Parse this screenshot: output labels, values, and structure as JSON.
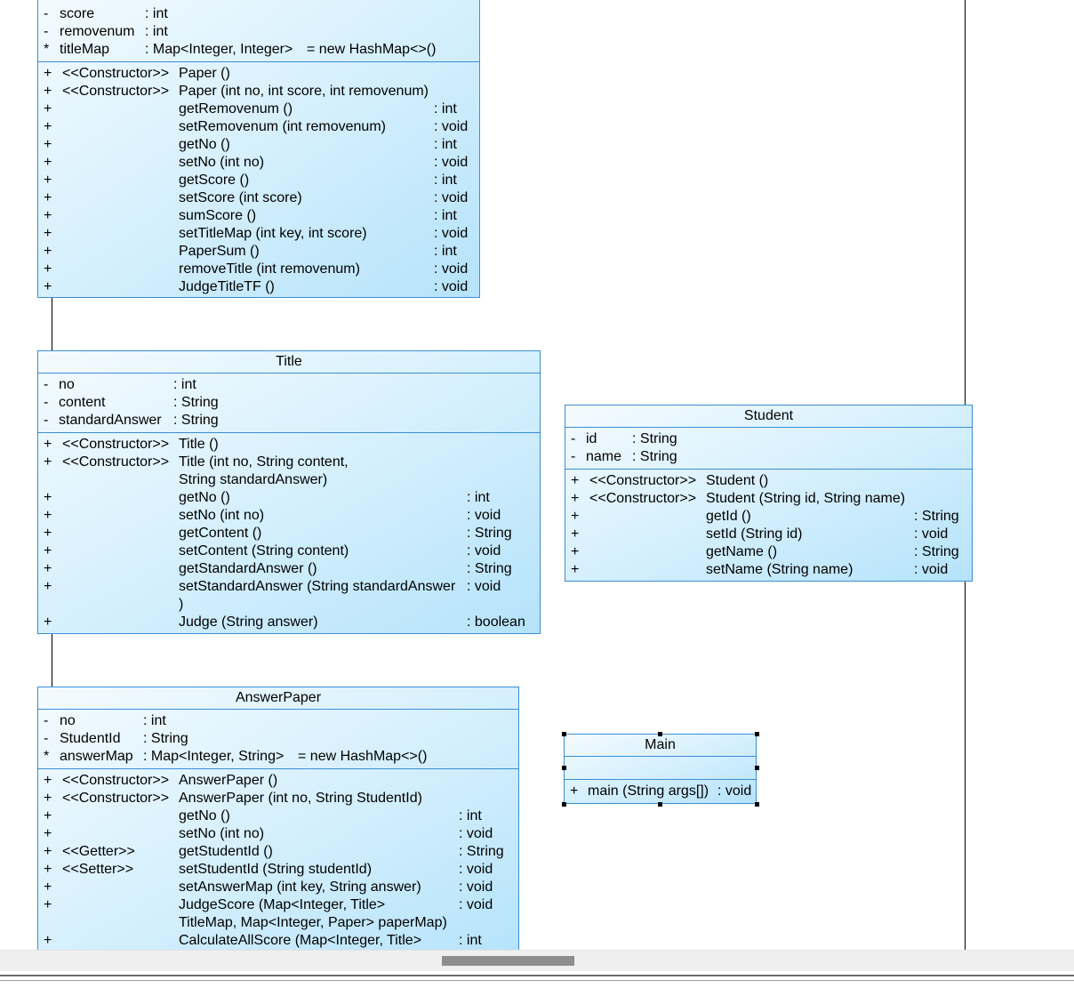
{
  "paper": {
    "attributes": [
      {
        "vis": "-",
        "name": "score",
        "type": ": int"
      },
      {
        "vis": "-",
        "name": "removenum",
        "type": ": int"
      },
      {
        "vis": "*",
        "name": "titleMap",
        "type": ": Map<Integer, Integer>",
        "init": "= new HashMap<>()"
      }
    ],
    "operations": [
      {
        "vis": "+",
        "stereo": "<<Constructor>>",
        "sig": "Paper ()",
        "ret": ""
      },
      {
        "vis": "+",
        "stereo": "<<Constructor>>",
        "sig": "Paper (int no, int score, int removenum)",
        "ret": ""
      },
      {
        "vis": "+",
        "stereo": "",
        "sig": "getRemovenum ()",
        "ret": ": int"
      },
      {
        "vis": "+",
        "stereo": "",
        "sig": "setRemovenum (int removenum)",
        "ret": ": void"
      },
      {
        "vis": "+",
        "stereo": "",
        "sig": "getNo ()",
        "ret": ": int"
      },
      {
        "vis": "+",
        "stereo": "",
        "sig": "setNo (int no)",
        "ret": ": void"
      },
      {
        "vis": "+",
        "stereo": "",
        "sig": "getScore ()",
        "ret": ": int"
      },
      {
        "vis": "+",
        "stereo": "",
        "sig": "setScore (int score)",
        "ret": ": void"
      },
      {
        "vis": "+",
        "stereo": "",
        "sig": "sumScore ()",
        "ret": ": int"
      },
      {
        "vis": "+",
        "stereo": "",
        "sig": "setTitleMap (int key, int score)",
        "ret": ": void"
      },
      {
        "vis": "+",
        "stereo": "",
        "sig": "PaperSum ()",
        "ret": ": int"
      },
      {
        "vis": "+",
        "stereo": "",
        "sig": "removeTitle (int removenum)",
        "ret": ": void"
      },
      {
        "vis": "+",
        "stereo": "",
        "sig": "JudgeTitleTF ()",
        "ret": ": void"
      }
    ]
  },
  "title_class": {
    "name": "Title",
    "attributes": [
      {
        "vis": "-",
        "name": "no",
        "type": ": int"
      },
      {
        "vis": "-",
        "name": "content",
        "type": ": String"
      },
      {
        "vis": "-",
        "name": "standardAnswer",
        "type": ": String"
      }
    ],
    "operations": [
      {
        "vis": "+",
        "stereo": "<<Constructor>>",
        "sig": "Title ()",
        "ret": ""
      },
      {
        "vis": "+",
        "stereo": "<<Constructor>>",
        "sig": "Title (int no, String content,",
        "ret": ""
      },
      {
        "vis": "",
        "stereo": "",
        "sig": " String standardAnswer)",
        "ret": ""
      },
      {
        "vis": "+",
        "stereo": "",
        "sig": "getNo ()",
        "ret": ": int"
      },
      {
        "vis": "+",
        "stereo": "",
        "sig": "setNo (int no)",
        "ret": ": void"
      },
      {
        "vis": "+",
        "stereo": "",
        "sig": "getContent ()",
        "ret": ": String"
      },
      {
        "vis": "+",
        "stereo": "",
        "sig": "setContent (String content)",
        "ret": ": void"
      },
      {
        "vis": "+",
        "stereo": "",
        "sig": "getStandardAnswer ()",
        "ret": ": String"
      },
      {
        "vis": "+",
        "stereo": "",
        "sig": "setStandardAnswer (String standardAnswer",
        "ret": ": void"
      },
      {
        "vis": "",
        "stereo": "",
        "sig": ")",
        "ret": ""
      },
      {
        "vis": "+",
        "stereo": "",
        "sig": "Judge (String answer)",
        "ret": ": boolean"
      }
    ]
  },
  "student": {
    "name": "Student",
    "attributes": [
      {
        "vis": "-",
        "name": "id",
        "type": ": String"
      },
      {
        "vis": "-",
        "name": "name",
        "type": ": String"
      }
    ],
    "operations": [
      {
        "vis": "+",
        "stereo": "<<Constructor>>",
        "sig": "Student ()",
        "ret": ""
      },
      {
        "vis": "+",
        "stereo": "<<Constructor>>",
        "sig": "Student (String id, String name)",
        "ret": ""
      },
      {
        "vis": "+",
        "stereo": "",
        "sig": "getId ()",
        "ret": ": String"
      },
      {
        "vis": "+",
        "stereo": "",
        "sig": "setId (String id)",
        "ret": ": void"
      },
      {
        "vis": "+",
        "stereo": "",
        "sig": "getName ()",
        "ret": ": String"
      },
      {
        "vis": "+",
        "stereo": "",
        "sig": "setName (String name)",
        "ret": ": void"
      }
    ]
  },
  "answerpaper": {
    "name": "AnswerPaper",
    "attributes": [
      {
        "vis": "-",
        "name": "no",
        "type": ": int"
      },
      {
        "vis": "-",
        "name": "StudentId",
        "type": ": String"
      },
      {
        "vis": "*",
        "name": "answerMap",
        "type": ": Map<Integer, String>",
        "init": "= new HashMap<>()"
      }
    ],
    "operations": [
      {
        "vis": "+",
        "stereo": "<<Constructor>>",
        "sig": "AnswerPaper ()",
        "ret": ""
      },
      {
        "vis": "+",
        "stereo": "<<Constructor>>",
        "sig": "AnswerPaper (int no, String StudentId)",
        "ret": ""
      },
      {
        "vis": "+",
        "stereo": "",
        "sig": "getNo ()",
        "ret": ": int"
      },
      {
        "vis": "+",
        "stereo": "",
        "sig": "setNo (int no)",
        "ret": ": void"
      },
      {
        "vis": "+",
        "stereo": "<<Getter>>",
        "sig": "getStudentId ()",
        "ret": ": String"
      },
      {
        "vis": "+",
        "stereo": "<<Setter>>",
        "sig": "setStudentId (String studentId)",
        "ret": ": void"
      },
      {
        "vis": "+",
        "stereo": "",
        "sig": "setAnswerMap (int key, String answer)",
        "ret": ": void"
      },
      {
        "vis": "+",
        "stereo": "",
        "sig": "JudgeScore (Map<Integer, Title>",
        "ret": ": void"
      },
      {
        "vis": "",
        "stereo": "",
        "sig": " TitleMap, Map<Integer, Paper> paperMap)",
        "ret": ""
      },
      {
        "vis": "+",
        "stereo": "",
        "sig": "CalculateAllScore (Map<Integer, Title>",
        "ret": ": int"
      }
    ]
  },
  "main_class": {
    "name": "Main",
    "operations": [
      {
        "vis": "+",
        "sig": "main (String args[])",
        "ret": ": void"
      }
    ]
  }
}
